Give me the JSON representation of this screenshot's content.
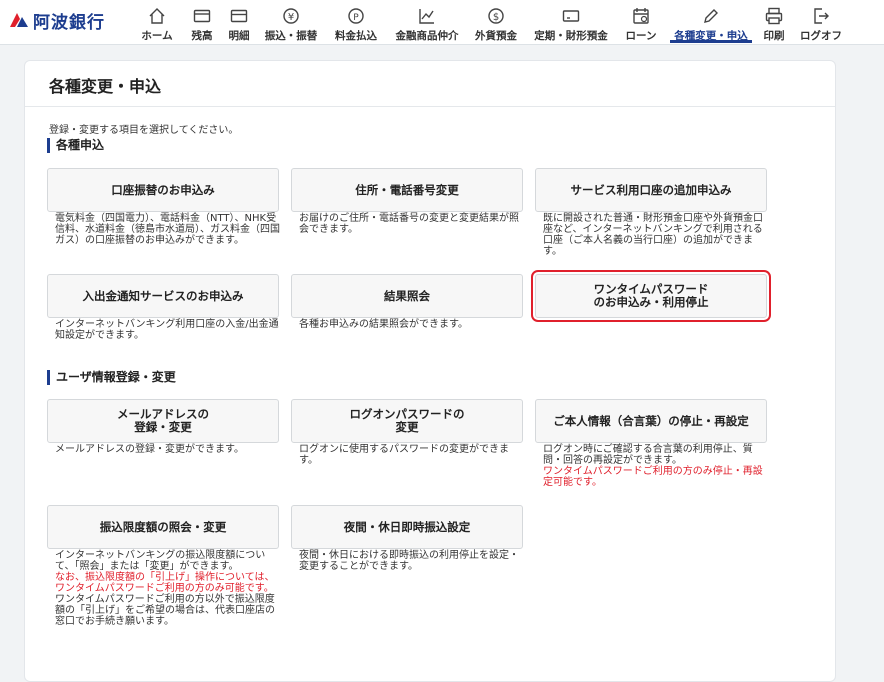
{
  "header": {
    "logo_text": "阿波銀行",
    "nav": [
      {
        "label": "ホーム",
        "icon": "home-icon"
      },
      {
        "label": "残高",
        "icon": "wallet-icon"
      },
      {
        "label": "明細",
        "icon": "statement-icon"
      },
      {
        "label": "振込・振替",
        "icon": "transfer-icon"
      },
      {
        "label": "料金払込",
        "icon": "payment-icon"
      },
      {
        "label": "金融商品仲介",
        "icon": "chart-icon"
      },
      {
        "label": "外貨預金",
        "icon": "dollar-icon"
      },
      {
        "label": "定期・財形預金",
        "icon": "deposit-icon"
      },
      {
        "label": "ローン",
        "icon": "loan-icon"
      },
      {
        "label": "各種変更・申込",
        "icon": "pen-icon"
      },
      {
        "label": "印刷",
        "icon": "print-icon"
      },
      {
        "label": "ログオフ",
        "icon": "logoff-icon"
      }
    ],
    "active_index": 9,
    "accent": "#1d3d8f"
  },
  "page": {
    "title": "各種変更・申込",
    "intro": "登録・変更する項目を選択してください。"
  },
  "sections": [
    {
      "heading": "各種申込",
      "cards": [
        {
          "label": "口座振替のお申込み",
          "desc": [
            "電気料金（四国電力）、電話料金（NTT）、NHK受信料、水道料金（徳島市水道局）、ガス料金（四国ガス）の口座振替のお申込みができます。"
          ],
          "red": []
        },
        {
          "label": "住所・電話番号変更",
          "desc": [
            "お届けのご住所・電話番号の変更と変更結果が照会できます。"
          ],
          "red": []
        },
        {
          "label": "サービス利用口座の追加申込み",
          "desc": [
            "既に開設された普通・財形預金口座や外貨預金口座など、インターネットバンキングで利用される口座（ご本人名義の当行口座）の追加ができます。"
          ],
          "red": []
        },
        {
          "label": "入出金通知サービスのお申込み",
          "desc": [
            "インターネットバンキング利用口座の入金/出金通知設定ができます。"
          ],
          "red": []
        },
        {
          "label": "結果照会",
          "desc": [
            "各種お申込みの結果照会ができます。"
          ],
          "red": []
        },
        {
          "label": "ワンタイムパスワード\nのお申込み・利用停止",
          "desc": [],
          "red": []
        }
      ]
    },
    {
      "heading": "ユーザ情報登録・変更",
      "cards": [
        {
          "label": "メールアドレスの\n登録・変更",
          "desc": [
            "メールアドレスの登録・変更ができます。"
          ],
          "red": []
        },
        {
          "label": "ログオンパスワードの\n変更",
          "desc": [
            "ログオンに使用するパスワードの変更ができます。"
          ],
          "red": []
        },
        {
          "label": "ご本人情報（合言葉）の停止・再設定",
          "desc": [
            "ログオン時にご確認する合言葉の利用停止、質問・回答の再設定ができます。"
          ],
          "red": [
            "ワンタイムパスワードご利用の方のみ停止・再設定可能です。"
          ]
        },
        {
          "label": "振込限度額の照会・変更",
          "desc": [
            "インターネットバンキングの振込限度額について、「照会」または「変更」ができます。"
          ],
          "red": [
            "なお、振込限度額の「引上げ」操作については、ワンタイムパスワードご利用の方のみ可能です。"
          ],
          "desc2": [
            "ワンタイムパスワードご利用の方以外で振込限度額の「引上げ」をご希望の場合は、代表口座店の窓口でお手続き願います。"
          ]
        },
        {
          "label": "夜間・休日即時振込設定",
          "desc": [
            "夜間・休日における即時振込の利用停止を設定・変更することができます。"
          ],
          "red": []
        }
      ]
    }
  ]
}
